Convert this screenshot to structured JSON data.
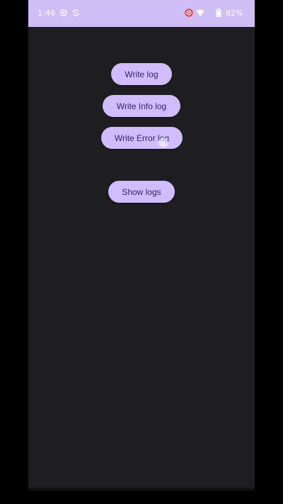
{
  "status_bar": {
    "time": "1:46",
    "battery": "82%",
    "icons": [
      "settings-icon",
      "sync-icon",
      "record-icon",
      "wifi-icon",
      "battery-icon"
    ]
  },
  "buttons": {
    "write_log": "Write log",
    "write_info_log": "Write Info log",
    "write_error_log": "Write Error log",
    "show_logs": "Show logs"
  },
  "colors": {
    "status_bar_bg": "#cfbdf6",
    "screen_bg": "#1e1e21",
    "button_bg": "#d0bcff",
    "button_text": "#37265e",
    "record_icon": "#e53945"
  }
}
